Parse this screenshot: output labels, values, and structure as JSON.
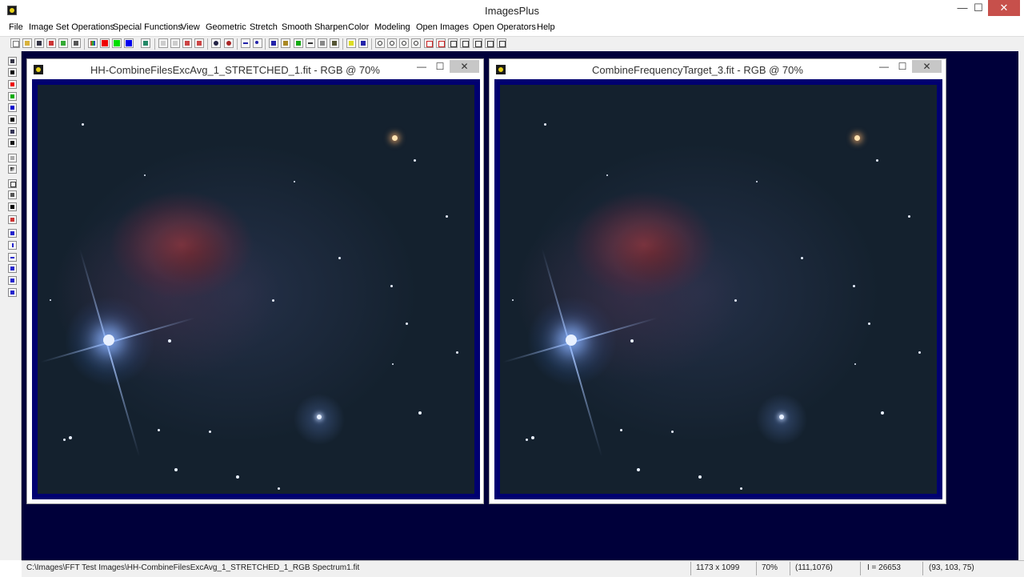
{
  "app": {
    "title": "ImagesPlus",
    "controls": {
      "minimize": "—",
      "maximize": "☐",
      "close": "✕"
    }
  },
  "menu": {
    "items": [
      "File",
      "Image Set Operations",
      "Special Functions",
      "View",
      "Geometric",
      "Stretch",
      "Smooth Sharpen",
      "Color",
      "Modeling",
      "Open Images",
      "Open Operators",
      "Help"
    ]
  },
  "windows": [
    {
      "title": "HH-CombineFilesExcAvg_1_STRETCHED_1.fit - RGB @ 70%",
      "controls": {
        "minimize": "—",
        "maximize": "☐",
        "close": "✕"
      }
    },
    {
      "title": "CombineFrequencyTarget_3.fit - RGB @ 70%",
      "controls": {
        "minimize": "—",
        "maximize": "☐",
        "close": "✕"
      }
    }
  ],
  "status": {
    "path": "C:\\Images\\FFT Test Images\\HH-CombineFilesExcAvg_1_STRETCHED_1_RGB Spectrum1.fit",
    "dimensions": "1173 x 1099",
    "zoom": "70%",
    "cursor": "(111,1076)",
    "intensity": "I = 26653",
    "rgb": "(93, 103, 75)"
  },
  "colors": {
    "workspace": "#00003a",
    "image_frame": "#000070",
    "close_button": "#c7504b"
  }
}
